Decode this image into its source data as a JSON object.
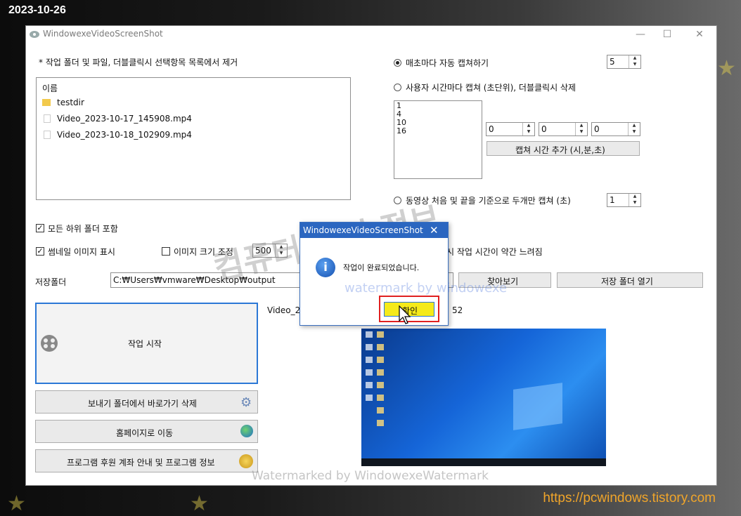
{
  "date_stamp": "2023-10-26",
  "site_url": "https://pcwindows.tistory.com",
  "window": {
    "title": "WindowexeVideoScreenShot",
    "controls": [
      "—",
      "☐",
      "✕"
    ]
  },
  "left": {
    "instruction": "* 작업 폴더 및 파일, 더블클릭시 선택항목 목록에서 제거",
    "list_header": "이름",
    "files": [
      "testdir",
      "Video_2023-10-17_145908.mp4",
      "Video_2023-10-18_102909.mp4"
    ],
    "include_subfolders_label": "모든 하위 폴더 포함",
    "show_thumb_label": "썸네일 이미지 표시",
    "resize_label": "이미지 크기 조정",
    "resize_value": "500",
    "save_folder_label": "저장폴더",
    "save_folder_value": "C:₩Users₩vmware₩Desktop₩output",
    "start_label": "작업 시작",
    "shortcut_delete_label": "보내기 폴더에서 바로가기 삭제",
    "homepage_label": "홈페이지로 이동",
    "sponsor_label": "프로그램 후원 계좌 안내 및 프로그램 정보"
  },
  "right": {
    "radio1_label": "매초마다 자동 캡쳐하기",
    "radio1_value": "5",
    "radio2_label": "사용자 시간마다 캡쳐 (초단위), 더블클릭시 삭제",
    "times": [
      "1",
      "4",
      "10",
      "16"
    ],
    "h_value": "0",
    "m_value": "0",
    "s_value": "0",
    "add_time_label": "캡쳐 시간 추가 (시,분,초)",
    "radio3_label": "동영상 처음 및 끝을 기준으로 두개만 캡쳐 (초)",
    "radio3_value": "1",
    "slow_note": "시 작업 시간이 약간 느려짐",
    "browse_label": "찾아보기",
    "open_folder_label": "저장 폴더 열기",
    "status_file": "Video_20",
    "status_count": "52"
  },
  "dialog": {
    "title": "WindowexeVideoScreenShot",
    "message": "작업이 완료되었습니다.",
    "ok_label": "확인"
  },
  "watermarks": {
    "big": "컴퓨터 관련 정보",
    "mid": "watermark by windowexe",
    "bottom": "Watermarked by WindowexeWatermark"
  },
  "colors": {
    "dialog_title": "#2b66c0",
    "highlight": "#f5ea1a",
    "site": "#f0a52a"
  }
}
